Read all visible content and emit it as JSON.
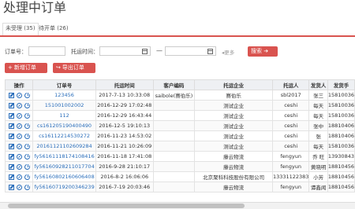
{
  "page": {
    "title": "处理中订单"
  },
  "tabs": [
    {
      "label": "未受理 (35)",
      "active": true
    },
    {
      "label": "待开单 (26)",
      "active": false
    }
  ],
  "filters": {
    "order_no_label": "订单号：",
    "time_label": "托运时间：",
    "dash": "—",
    "more": "更多",
    "search_label": "搜索"
  },
  "actions": {
    "new_label": "新增订单",
    "export_label": "导出订单"
  },
  "table": {
    "headers": [
      "操作",
      "订单号",
      "托运时间",
      "客户编码",
      "托运企业",
      "托运人",
      "发货人",
      "发货手"
    ],
    "rows": [
      [
        "123456",
        "2017-7-13 10:33:08",
        "saibole(赛伯乐)",
        "赛伯乐",
        "sbl2017",
        "张三",
        "15810036"
      ],
      [
        "151001002002",
        "2016-12-29 17:02:48",
        "",
        "测试企业",
        "ceshi",
        "每天",
        "15810036"
      ],
      [
        "112",
        "2016-12-29 16:43:44",
        "",
        "测试企业",
        "ceshi",
        "每天",
        "15810036"
      ],
      [
        "cs161205190400490",
        "2016-12-5 19:10:13",
        "",
        "测试企业",
        "ceshi",
        "张中",
        "18810406"
      ],
      [
        "cs16112214530272",
        "2016-11-23 14:53:02",
        "",
        "测试企业",
        "ceshi",
        "张",
        "18810406"
      ],
      [
        "20161121102609284",
        "2016-11-21 10:26:09",
        "",
        "测试企业",
        "ceshi",
        "每天",
        "15810036"
      ],
      [
        "fy56161118174108416",
        "2016-11-18 17:41:08",
        "",
        "藤云物流",
        "fengyun",
        "乔 旺",
        "13930843"
      ],
      [
        "fy56160928211017704",
        "2016-9-28 21:10:17",
        "",
        "藤云物流",
        "fengyun",
        "黄晓明",
        "18810456"
      ],
      [
        "fy56160802160606408",
        "2016-8-2 16:06:06",
        "",
        "北京聚科科技股份有限公司",
        "13331122383",
        "小芳",
        "18810456"
      ],
      [
        "fy56160719200346239",
        "2016-7-19 20:03:46",
        "",
        "藤云物流",
        "fengyun",
        "谭鑫闻",
        "18810456"
      ]
    ]
  }
}
